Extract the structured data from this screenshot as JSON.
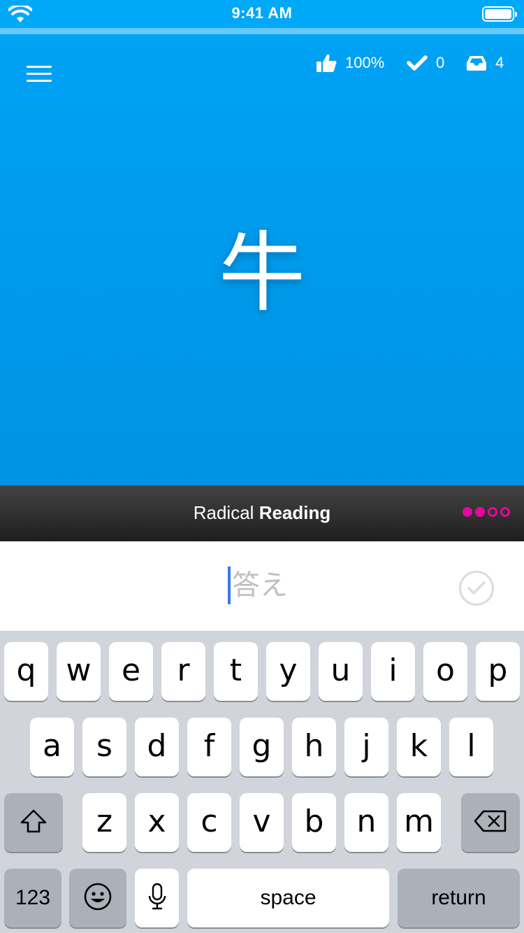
{
  "status_bar": {
    "time": "9:41 AM"
  },
  "header": {
    "success_rate": "100%",
    "completed_count": "0",
    "queue_count": "4"
  },
  "subject": {
    "character": "牛"
  },
  "question": {
    "type_label": "Radical",
    "reading_label": "Reading"
  },
  "answer": {
    "placeholder": "答え",
    "value": ""
  },
  "colors": {
    "card_blue": "#00a2f4",
    "dot_magenta": "#e4099a",
    "caret_blue": "#3478f6"
  },
  "keyboard": {
    "row1": [
      "q",
      "w",
      "e",
      "r",
      "t",
      "y",
      "u",
      "i",
      "o",
      "p"
    ],
    "row2": [
      "a",
      "s",
      "d",
      "f",
      "g",
      "h",
      "j",
      "k",
      "l"
    ],
    "row3": [
      "z",
      "x",
      "c",
      "v",
      "b",
      "n",
      "m"
    ],
    "numbers_label": "123",
    "space_label": "space",
    "return_label": "return"
  }
}
